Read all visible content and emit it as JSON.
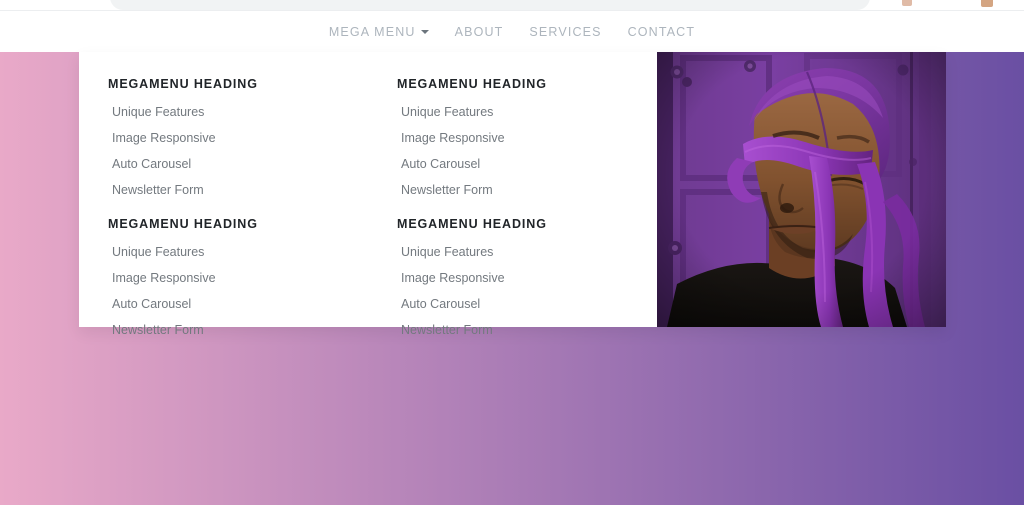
{
  "browser": {
    "omnibox_value": "",
    "icons": [
      "extension-icon",
      "profile-avatar-icon"
    ]
  },
  "navbar": {
    "items": [
      {
        "label": "MEGA MENU",
        "has_caret": true,
        "active": true,
        "icon": "chevron-down-icon"
      },
      {
        "label": "ABOUT",
        "has_caret": false,
        "active": false
      },
      {
        "label": "SERVICES",
        "has_caret": false,
        "active": false
      },
      {
        "label": "CONTACT",
        "has_caret": false,
        "active": false
      }
    ]
  },
  "megamenu": {
    "open": true,
    "columns": [
      {
        "heading": "MEGAMENU HEADING",
        "links": [
          "Unique Features",
          "Image Responsive",
          "Auto Carousel",
          "Newsletter Form"
        ]
      },
      {
        "heading": "MEGAMENU HEADING",
        "links": [
          "Unique Features",
          "Image Responsive",
          "Auto Carousel",
          "Newsletter Form"
        ]
      },
      {
        "heading": "MEGAMENU HEADING",
        "links": [
          "Unique Features",
          "Image Responsive",
          "Auto Carousel",
          "Newsletter Form"
        ]
      },
      {
        "heading": "MEGAMENU HEADING",
        "links": [
          "Unique Features",
          "Image Responsive",
          "Auto Carousel",
          "Newsletter Form"
        ]
      }
    ],
    "media": {
      "alt": "Man wearing a purple durag in front of a purple door",
      "icon": "promo-photo"
    }
  },
  "colors": {
    "panel_background": "#ffffff",
    "heading_text": "#212529",
    "link_text": "#73797f",
    "nav_text": "#adb5bd",
    "gradient_start": "#e9a9c8",
    "gradient_end": "#6a4fa3",
    "photo_purple": "#7b3fa0",
    "photo_purple_dark": "#3a1a4a",
    "photo_skin": "#8a5a3c",
    "photo_shirt": "#15120f"
  }
}
